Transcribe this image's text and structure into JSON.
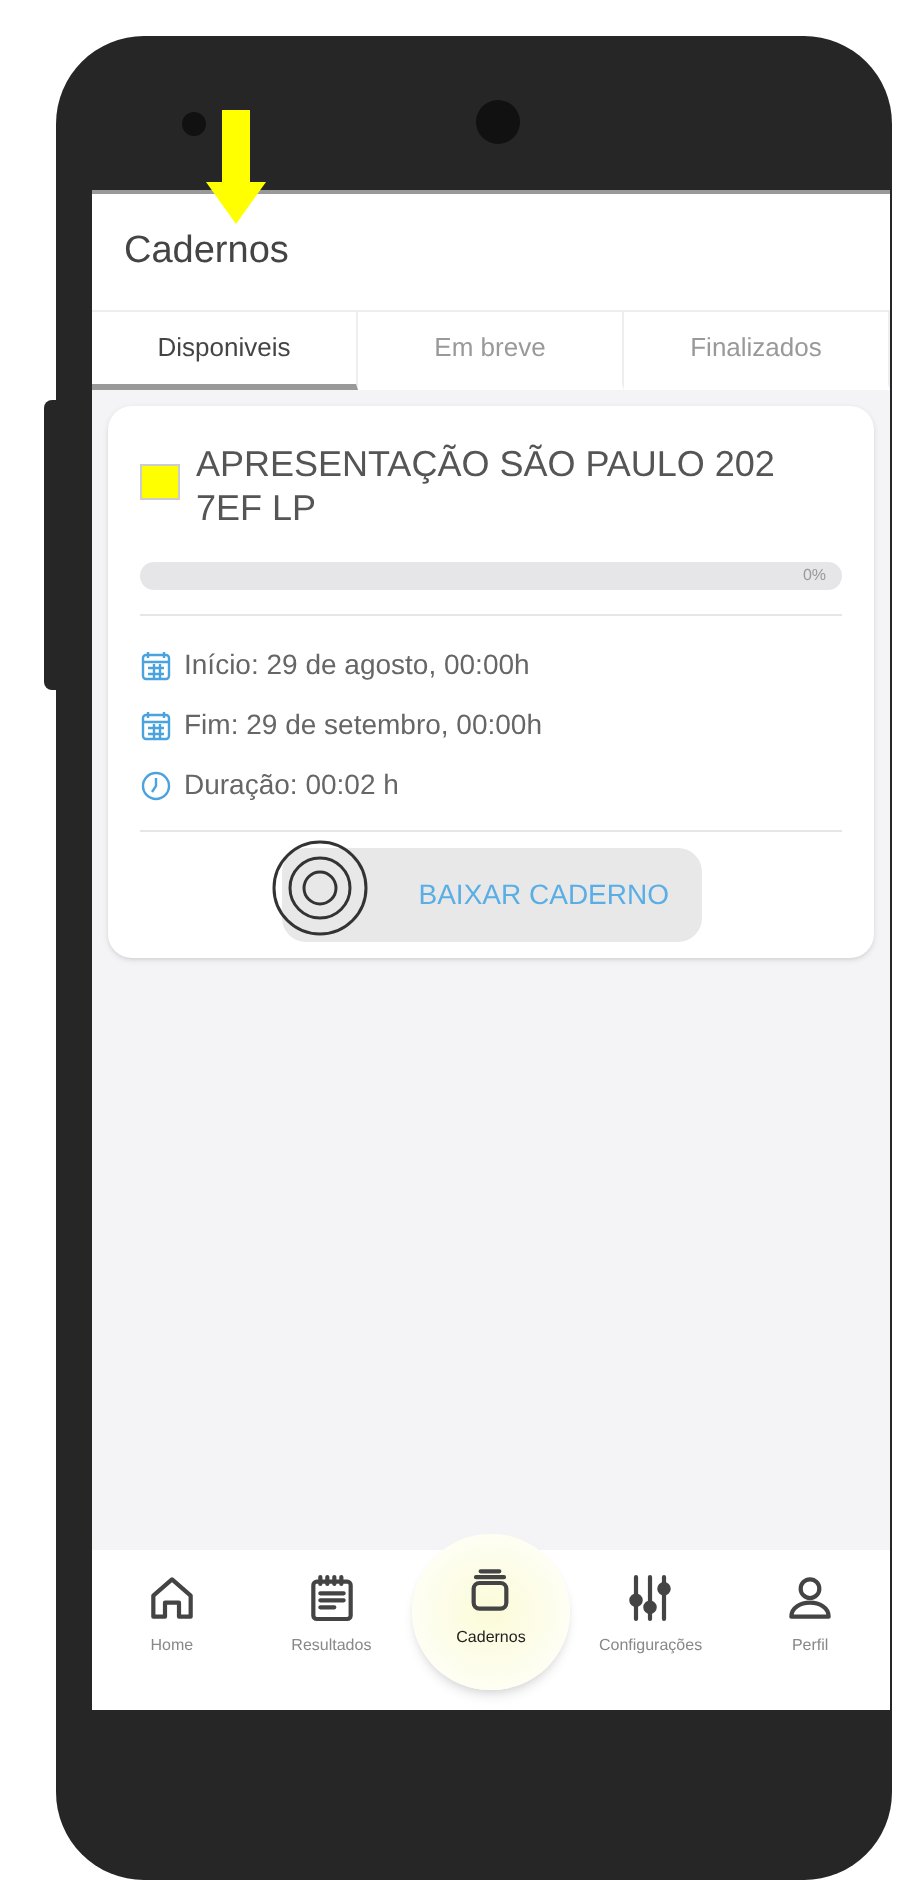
{
  "header": {
    "title": "Cadernos"
  },
  "tabs": [
    {
      "label": "Disponiveis",
      "selected": true
    },
    {
      "label": "Em breve",
      "selected": false
    },
    {
      "label": "Finalizados",
      "selected": false
    }
  ],
  "card": {
    "color": "#ffff00",
    "title": "APRESENTAÇÃO SÃO PAULO 202",
    "subtitle": "7EF LP",
    "progress": {
      "level": 0,
      "reading": "0%"
    },
    "details": [
      {
        "kind": "calendar",
        "text": "Início: 29 de agosto, 00:00h"
      },
      {
        "kind": "calendar",
        "text": "Fim: 29 de setembro, 00:00h"
      },
      {
        "kind": "clock",
        "text": "Duração: 00:02 h"
      }
    ],
    "button": "BAIXAR CADERNO"
  },
  "bottom_nav": [
    {
      "kind": "home",
      "label": "Home",
      "selected": false
    },
    {
      "kind": "results",
      "label": "Resultados",
      "selected": false
    },
    {
      "kind": "notebooks",
      "label": "Cadernos",
      "selected": true
    },
    {
      "kind": "settings",
      "label": "Configurações",
      "selected": false
    },
    {
      "kind": "profile",
      "label": "Perfil",
      "selected": false
    }
  ]
}
